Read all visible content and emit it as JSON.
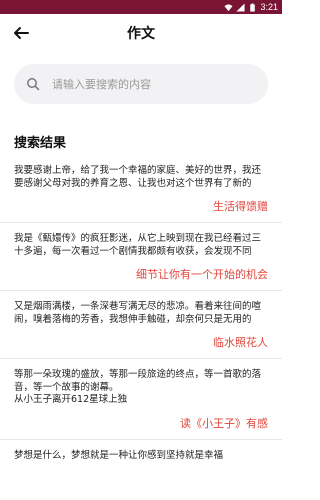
{
  "status_bar": {
    "time": "3:21"
  },
  "header": {
    "title": "作文"
  },
  "search": {
    "placeholder": "请输入要搜索的内容"
  },
  "section_title": "搜索结果",
  "results": [
    {
      "text": "我要感谢上帝，给了我一个幸福的家庭、美好的世界，我还要感谢父母对我的养育之恩、让我也对这个世界有了新的",
      "title": "生活得馈赠"
    },
    {
      "text": "我是《甄嬛传》的疯狂影迷，从它上映到现在我已经看过三十多遍，每一次看过一个剧情我都颇有收获，会发现不同",
      "title": "细节让你有一个开始的机会"
    },
    {
      "text": "又是烟雨满楼，一条深巷写满无尽的悲凉。看着来往间的喧闹，嗅着落梅的芳香，我想伸手触碰，却奈何只是无用的",
      "title": "临水照花人"
    },
    {
      "text": "等那一朵玫瑰的盛放，等那一段旅途的终点，等一首歌的落音，等一个故事的谢幕。\n从小王子离开612星球上独",
      "title": "读《小王子》有感"
    },
    {
      "text": "梦想是什么，梦想就是一种让你感到坚持就是幸福",
      "title": ""
    }
  ]
}
